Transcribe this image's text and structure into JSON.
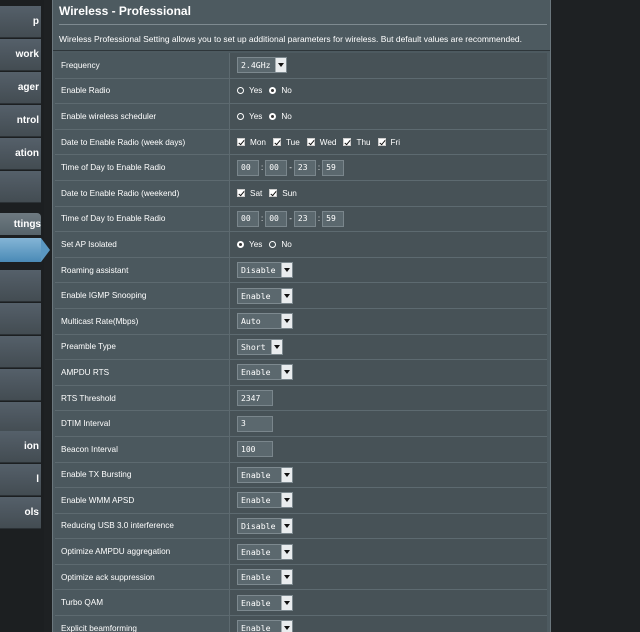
{
  "sidebar": {
    "top_items": [
      "p",
      "work",
      "ager",
      "ntrol",
      "ation"
    ],
    "section_header": "ttings",
    "bottom_items": [
      "ion",
      "l",
      "ols"
    ]
  },
  "page": {
    "title": "Wireless - Professional",
    "description": "Wireless Professional Setting allows you to set up additional parameters for wireless. But default values are recommended."
  },
  "settings": {
    "frequency": {
      "label": "Frequency",
      "value": "2.4GHz"
    },
    "enable_radio": {
      "label": "Enable Radio",
      "yes": "Yes",
      "no": "No",
      "selected": "No"
    },
    "wireless_scheduler": {
      "label": "Enable wireless scheduler",
      "yes": "Yes",
      "no": "No",
      "selected": "No"
    },
    "weekdays": {
      "label": "Date to Enable Radio (week days)",
      "days": [
        "Mon",
        "Tue",
        "Wed",
        "Thu",
        "Fri"
      ]
    },
    "time_weekdays": {
      "label": "Time of Day to Enable Radio",
      "start_h": "00",
      "start_m": "00",
      "end_h": "23",
      "end_m": "59"
    },
    "weekend": {
      "label": "Date to Enable Radio (weekend)",
      "days": [
        "Sat",
        "Sun"
      ]
    },
    "time_weekend": {
      "label": "Time of Day to Enable Radio",
      "start_h": "00",
      "start_m": "00",
      "end_h": "23",
      "end_m": "59"
    },
    "ap_isolated": {
      "label": "Set AP Isolated",
      "yes": "Yes",
      "no": "No",
      "selected": "Yes"
    },
    "roaming": {
      "label": "Roaming assistant",
      "value": "Disable"
    },
    "igmp": {
      "label": "Enable IGMP Snooping",
      "value": "Enable"
    },
    "multicast": {
      "label": "Multicast Rate(Mbps)",
      "value": "Auto"
    },
    "preamble": {
      "label": "Preamble Type",
      "value": "Short"
    },
    "ampdu_rts": {
      "label": "AMPDU RTS",
      "value": "Enable"
    },
    "rts_threshold": {
      "label": "RTS Threshold",
      "value": "2347"
    },
    "dtim": {
      "label": "DTIM Interval",
      "value": "3"
    },
    "beacon": {
      "label": "Beacon Interval",
      "value": "100"
    },
    "tx_bursting": {
      "label": "Enable TX Bursting",
      "value": "Enable"
    },
    "wmm_apsd": {
      "label": "Enable WMM APSD",
      "value": "Enable"
    },
    "usb3": {
      "label": "Reducing USB 3.0 interference",
      "value": "Disable"
    },
    "ampdu_agg": {
      "label": "Optimize AMPDU aggregation",
      "value": "Enable"
    },
    "ack_supp": {
      "label": "Optimize ack suppression",
      "value": "Enable"
    },
    "turbo_qam": {
      "label": "Turbo QAM",
      "value": "Enable"
    },
    "beamforming": {
      "label": "Explicit beamforming",
      "value": "Enable"
    }
  },
  "separators": {
    "colon": ":",
    "dash": "-"
  }
}
